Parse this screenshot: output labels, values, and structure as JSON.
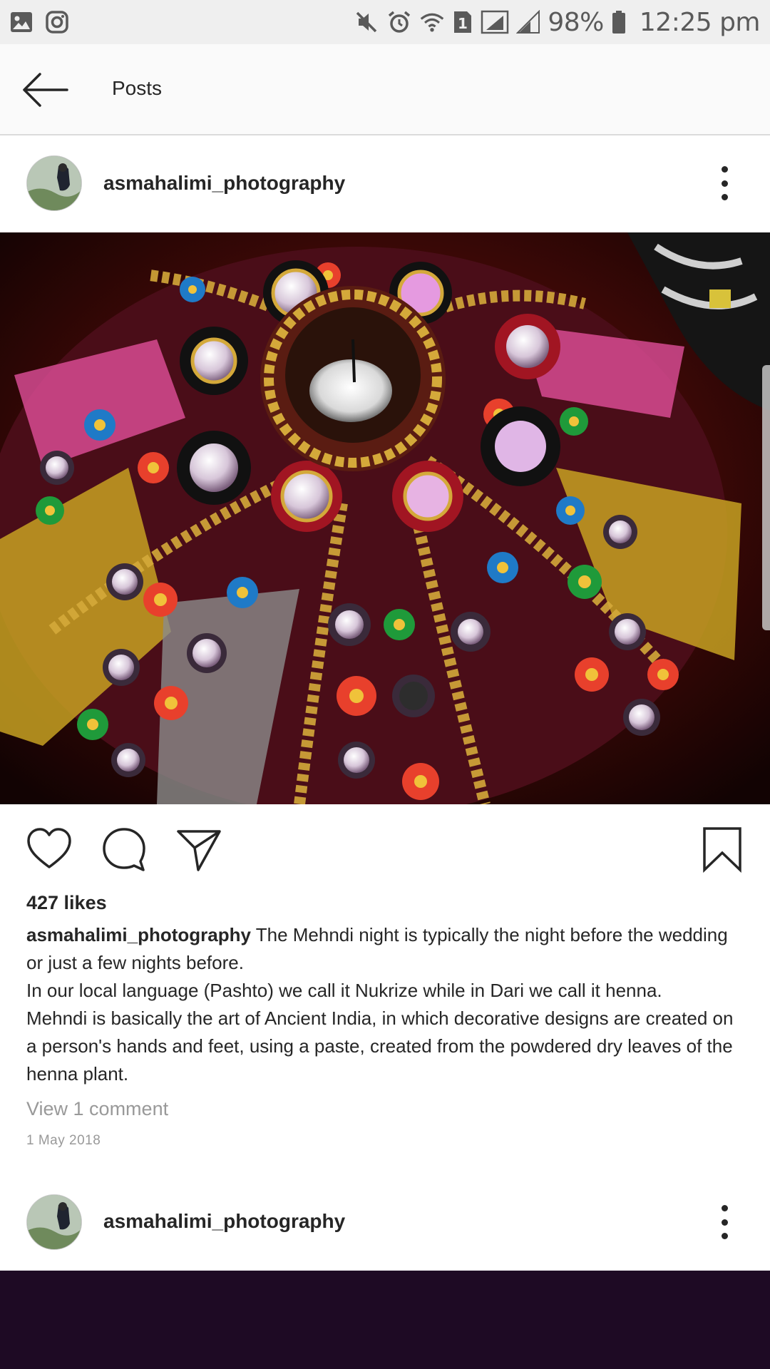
{
  "status_bar": {
    "left_icons": [
      "gallery-icon",
      "instagram-icon"
    ],
    "right_icons": [
      "mute-icon",
      "alarm-icon",
      "wifi-icon",
      "sim-1-icon",
      "signal-icon",
      "signal-icon",
      "battery-icon"
    ],
    "sim_label": "1",
    "battery": "98%",
    "time": "12:25 pm"
  },
  "header": {
    "back_icon": "back-arrow-icon",
    "title": "Posts"
  },
  "posts": [
    {
      "username": "asmahalimi_photography",
      "likes": "427 likes",
      "caption_user": "asmahalimi_photography",
      "caption_lines": [
        "The Mehndi night is typically the night before the wedding or just a few nights before.",
        "In our local language (Pashto)  we call it Nukrize while in Dari we call it henna.",
        "Mehndi is basically the art of Ancient India, in which decorative designs are created on a person's hands and feet, using a paste, created from the powdered dry leaves of the henna plant."
      ],
      "view_comments": "View 1 comment",
      "date": "1 May 2018"
    },
    {
      "username": "asmahalimi_photography"
    }
  ],
  "actions": {
    "like_icon": "heart-icon",
    "comment_icon": "comment-icon",
    "share_icon": "send-icon",
    "save_icon": "bookmark-icon"
  }
}
